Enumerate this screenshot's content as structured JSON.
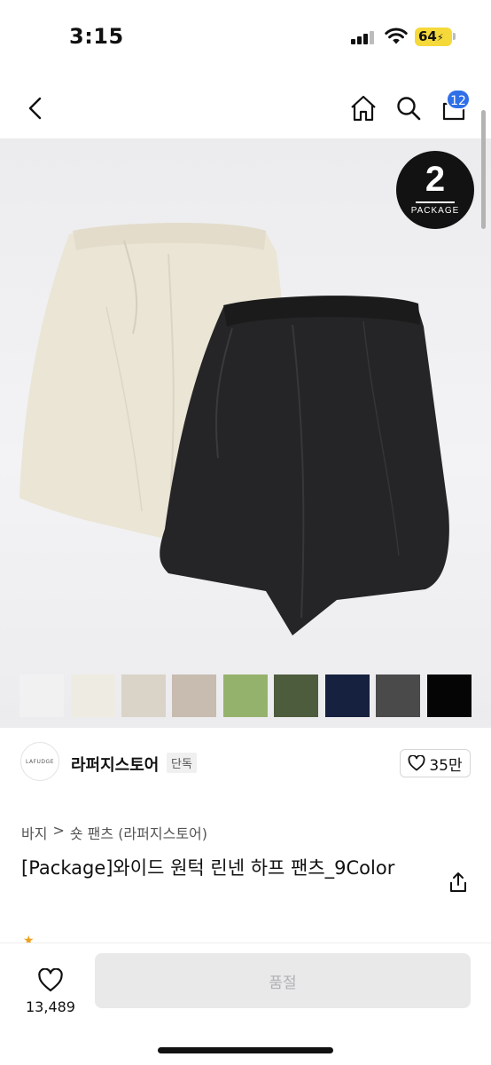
{
  "status_bar": {
    "time": "3:15",
    "battery": "64"
  },
  "nav": {
    "cart_count": "12",
    "icons": [
      "back-icon",
      "home-icon",
      "search-icon",
      "cart-icon"
    ]
  },
  "hero": {
    "badge_number": "2",
    "badge_text": "PACKAGE",
    "swatches": [
      {
        "color": "#f1f1f1"
      },
      {
        "color": "#eeebe2"
      },
      {
        "color": "#dad3c8"
      },
      {
        "color": "#c8bbb0"
      },
      {
        "color": "#95b26d"
      },
      {
        "color": "#4d5c3c"
      },
      {
        "color": "#16213f"
      },
      {
        "color": "#4a4a4a"
      },
      {
        "color": "#050505"
      }
    ]
  },
  "store": {
    "logo_text": "LAFUDGE",
    "name": "라퍼지스토어",
    "tag": "단독",
    "likes": "35만"
  },
  "breadcrumb": {
    "category": "바지",
    "separator": ">",
    "subcategory": "숏 팬츠 (라퍼지스토어)"
  },
  "product": {
    "title": "[Package]와이드 원턱 린넨 하프 팬츠_9Color"
  },
  "bottom_bar": {
    "wish_count": "13,489",
    "buy_label": "품절"
  },
  "colors": {
    "badge": "#2f6fe8",
    "battery": "#f5d83a"
  }
}
